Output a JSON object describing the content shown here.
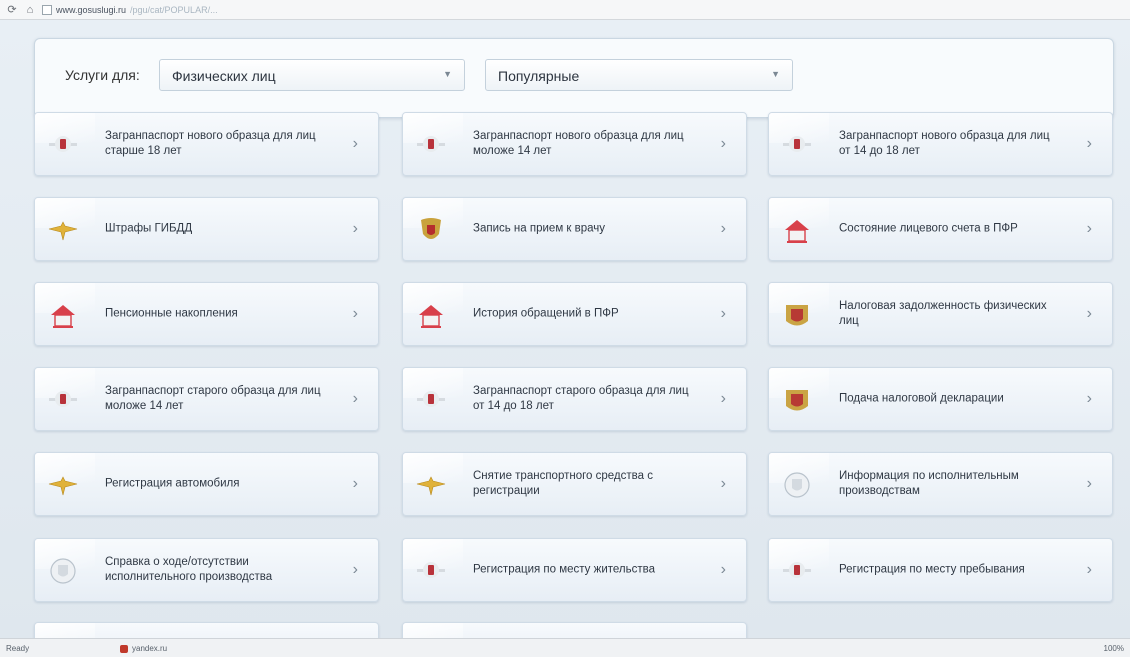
{
  "browser": {
    "url_host": "www.gosuslugi.ru",
    "url_path": "/pgu/cat/POPULAR/..."
  },
  "filter": {
    "label": "Услуги для:",
    "audience": "Физических лиц",
    "category": "Популярные"
  },
  "tiles": [
    {
      "label": "Загранпаспорт нового образца для лиц старше 18 лет",
      "icon": "emblem-red-icon"
    },
    {
      "label": "Загранпаспорт нового образца для лиц моложе 14 лет",
      "icon": "emblem-red-icon"
    },
    {
      "label": "Загранпаспорт нового образца для лиц от 14 до 18 лет",
      "icon": "emblem-red-icon"
    },
    {
      "label": "Штрафы ГИБДД",
      "icon": "gold-eagle-icon"
    },
    {
      "label": "Запись на прием к врачу",
      "icon": "coat-of-arms-icon"
    },
    {
      "label": "Состояние лицевого счета в ПФР",
      "icon": "pension-fund-icon"
    },
    {
      "label": "Пенсионные накопления",
      "icon": "pension-fund-icon"
    },
    {
      "label": "История обращений в ПФР",
      "icon": "pension-fund-icon"
    },
    {
      "label": "Налоговая задолженность физических лиц",
      "icon": "tax-emblem-icon"
    },
    {
      "label": "Загранпаспорт старого образца для лиц моложе 14 лет",
      "icon": "emblem-red-icon"
    },
    {
      "label": "Загранпаспорт старого образца для лиц от 14 до 18 лет",
      "icon": "emblem-red-icon"
    },
    {
      "label": "Подача налоговой декларации",
      "icon": "tax-emblem-icon"
    },
    {
      "label": "Регистрация автомобиля",
      "icon": "gold-eagle-icon"
    },
    {
      "label": "Снятие транспортного средства с регистрации",
      "icon": "gold-eagle-icon"
    },
    {
      "label": "Информация по исполнительным производствам",
      "icon": "bailiff-emblem-icon"
    },
    {
      "label": "Справка о ходе/отсутствии исполнительного производства",
      "icon": "bailiff-emblem-icon"
    },
    {
      "label": "Регистрация по месту жительства",
      "icon": "emblem-red-icon"
    },
    {
      "label": "Регистрация по месту пребывания",
      "icon": "emblem-red-icon"
    }
  ],
  "arrow": "›",
  "statusbar": {
    "left": "Ready",
    "tab": "yandex.ru",
    "right": "100%"
  }
}
